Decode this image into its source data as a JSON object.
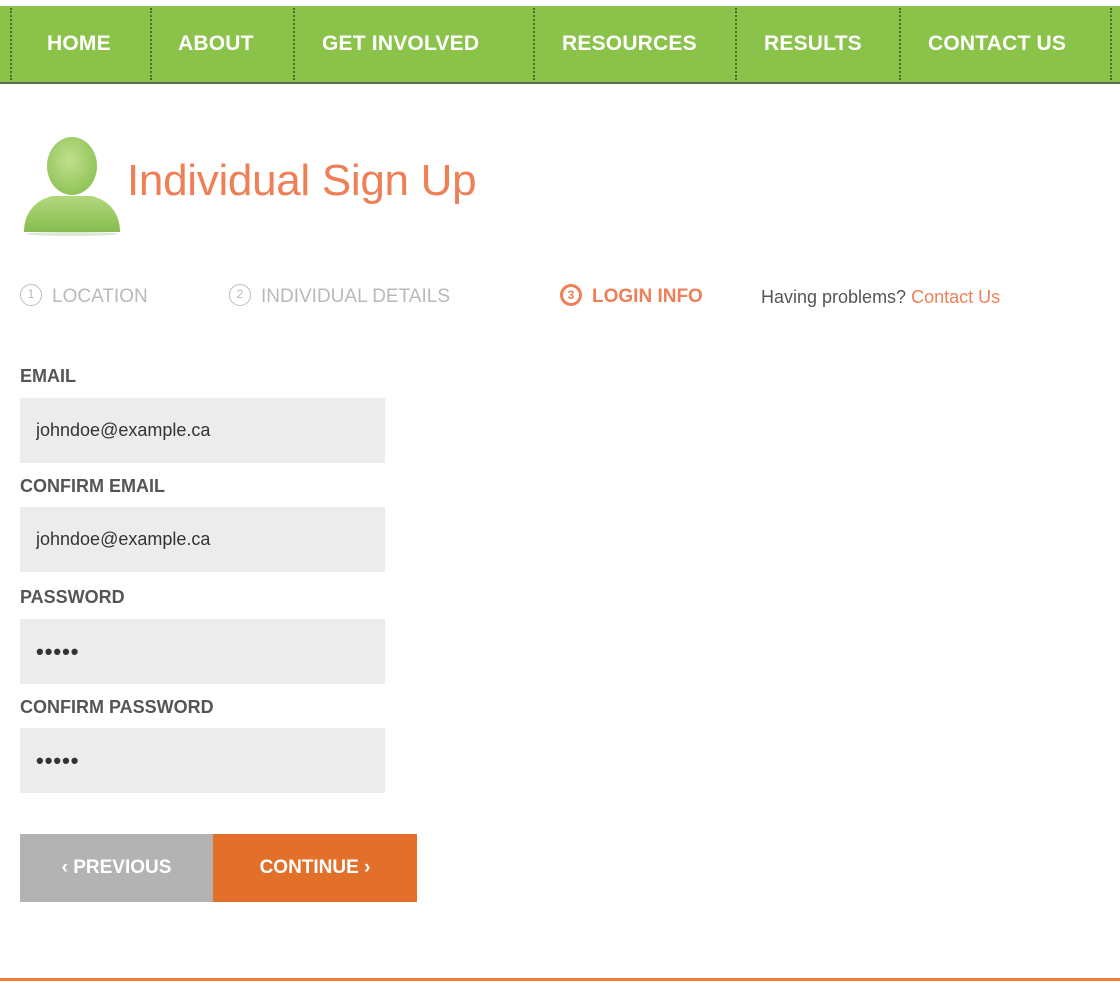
{
  "nav": {
    "items": [
      {
        "label": "HOME"
      },
      {
        "label": "ABOUT"
      },
      {
        "label": "GET INVOLVED"
      },
      {
        "label": "RESOURCES"
      },
      {
        "label": "RESULTS"
      },
      {
        "label": "CONTACT US"
      }
    ]
  },
  "header": {
    "title": "Individual Sign Up",
    "avatar_icon": "person-silhouette-icon"
  },
  "steps": [
    {
      "number": "1",
      "label": "LOCATION",
      "state": "done"
    },
    {
      "number": "2",
      "label": "INDIVIDUAL DETAILS",
      "state": "done"
    },
    {
      "number": "3",
      "label": "LOGIN INFO",
      "state": "active"
    }
  ],
  "help": {
    "text": "Having problems?",
    "link": "Contact Us"
  },
  "form": {
    "email": {
      "label": "EMAIL",
      "value": "johndoe@example.ca"
    },
    "confirm_email": {
      "label": "CONFIRM EMAIL",
      "value": "johndoe@example.ca"
    },
    "password": {
      "label": "PASSWORD",
      "value": "•••••"
    },
    "confirm_password": {
      "label": "CONFIRM PASSWORD",
      "value": "•••••"
    }
  },
  "buttons": {
    "previous": "‹ PREVIOUS",
    "continue": "CONTINUE ›"
  },
  "colors": {
    "nav_green": "#8bc34a",
    "accent_orange": "#ee7f56",
    "continue_orange": "#e3702a",
    "previous_gray": "#b3b3b3",
    "input_gray": "#ececec"
  }
}
